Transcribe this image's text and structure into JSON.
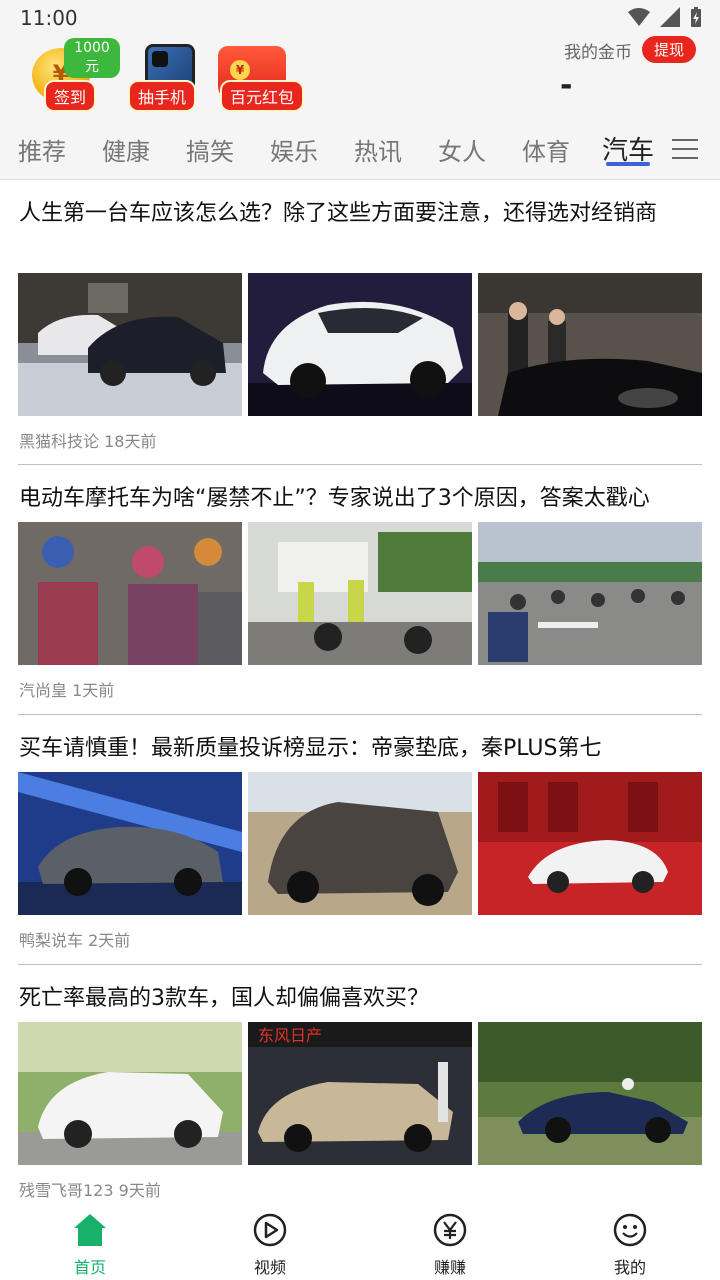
{
  "status_bar": {
    "time": "11:00"
  },
  "header": {
    "promos": [
      {
        "label": "签到",
        "badge": "1000元",
        "coin_symbol": "¥"
      },
      {
        "label": "抽手机"
      },
      {
        "label": "百元红包",
        "coin_symbol": "¥"
      }
    ],
    "gold": {
      "label": "我的金币",
      "value": "-",
      "withdraw_label": "提现"
    }
  },
  "tabs": [
    "推荐",
    "健康",
    "搞笑",
    "娱乐",
    "热讯",
    "女人",
    "体育",
    "汽车"
  ],
  "active_tab": "汽车",
  "articles": [
    {
      "title": "人生第一台车应该怎么选？除了这些方面要注意，还得选对经销商",
      "source": "黑猫科技论",
      "time": "18天前"
    },
    {
      "title": "电动车摩托车为啥“屡禁不止”？专家说出了3个原因，答案太戳心",
      "source": "汽尚皇",
      "time": "1天前"
    },
    {
      "title": "买车请慎重！最新质量投诉榜显示：帝豪垫底，秦PLUS第七",
      "source": "鸭梨说车",
      "time": "2天前"
    },
    {
      "title": "死亡率最高的3款车，国人却偏偏喜欢买？",
      "source": "残雪飞哥123",
      "time": "9天前"
    }
  ],
  "bottom_nav": [
    {
      "label": "首页",
      "icon": "home-icon"
    },
    {
      "label": "视频",
      "icon": "play-icon"
    },
    {
      "label": "赚赚",
      "icon": "yuan-icon"
    },
    {
      "label": "我的",
      "icon": "smile-icon"
    }
  ],
  "colors": {
    "accent_green": "#18b06a",
    "red": "#e8261d",
    "tab_underline": "#3a64d8"
  }
}
